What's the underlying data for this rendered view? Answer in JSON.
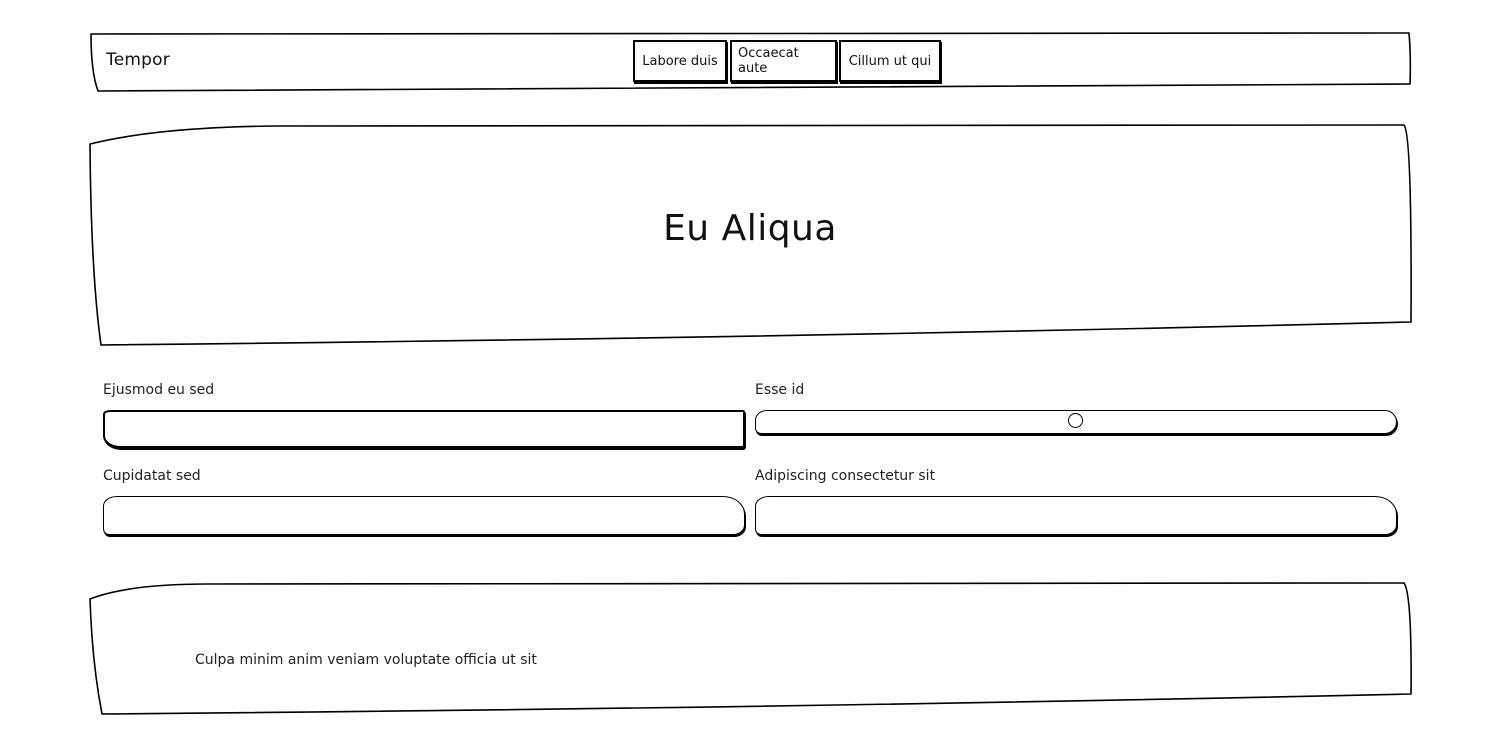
{
  "navbar": {
    "brand": "Tempor",
    "links": [
      "Labore duis",
      "Occaecat aute",
      "Cillum ut qui"
    ]
  },
  "hero": {
    "title": "Eu Aliqua"
  },
  "form": {
    "field_1": {
      "label": "Ejusmod eu sed",
      "value": ""
    },
    "slider": {
      "label": "Esse id",
      "value_percent": 50
    },
    "field_2": {
      "label": "Cupidatat sed",
      "value": ""
    },
    "field_3": {
      "label": "Adipiscing consectetur sit",
      "value": ""
    }
  },
  "footer": {
    "text": "Culpa minim anim veniam voluptate officia ut sit"
  }
}
